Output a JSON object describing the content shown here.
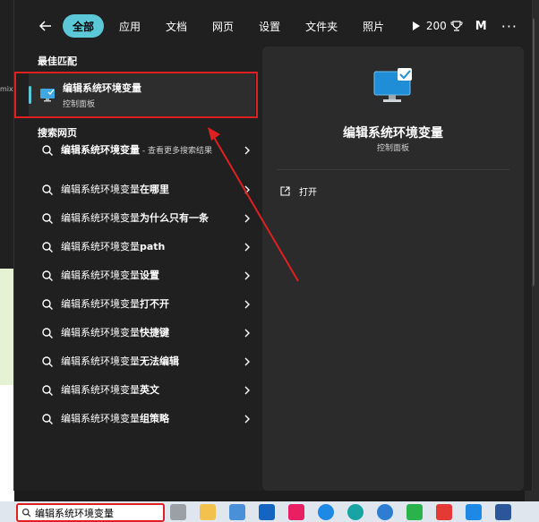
{
  "background": {
    "left_snippet": "mixe"
  },
  "topbar": {
    "filters": [
      {
        "label": "全部",
        "active": true
      },
      {
        "label": "应用",
        "active": false
      },
      {
        "label": "文档",
        "active": false
      },
      {
        "label": "网页",
        "active": false
      },
      {
        "label": "设置",
        "active": false
      },
      {
        "label": "文件夹",
        "active": false
      },
      {
        "label": "照片",
        "active": false
      }
    ],
    "points": "200",
    "avatar": "M",
    "more": "···"
  },
  "best_match": {
    "section_title": "最佳匹配",
    "name": "编辑系统环境变量",
    "subtitle": "控制面板"
  },
  "web_search": {
    "section_title": "搜索网页",
    "items": [
      {
        "base": "编辑系统环境变量",
        "bold": "",
        "suffix": " - 查看更多搜索结果"
      },
      {
        "base": "编辑系统环境变量",
        "bold": "在哪里",
        "suffix": ""
      },
      {
        "base": "编辑系统环境变量",
        "bold": "为什么只有一条",
        "suffix": ""
      },
      {
        "base": "编辑系统环境变量",
        "bold": "path",
        "suffix": ""
      },
      {
        "base": "编辑系统环境变量",
        "bold": "设置",
        "suffix": ""
      },
      {
        "base": "编辑系统环境变量",
        "bold": "打不开",
        "suffix": ""
      },
      {
        "base": "编辑系统环境变量",
        "bold": "快捷键",
        "suffix": ""
      },
      {
        "base": "编辑系统环境变量",
        "bold": "无法编辑",
        "suffix": ""
      },
      {
        "base": "编辑系统环境变量",
        "bold": "英文",
        "suffix": ""
      },
      {
        "base": "编辑系统环境变量",
        "bold": "组策略",
        "suffix": ""
      }
    ]
  },
  "detail": {
    "title": "编辑系统环境变量",
    "subtitle": "控制面板",
    "open_label": "打开"
  },
  "taskbar": {
    "search_value": "编辑系统环境变量",
    "apps": [
      "file-stack",
      "file-explorer",
      "store",
      "lens-l",
      "app-pink",
      "app-k",
      "edge",
      "edge-dev",
      "wechat",
      "wps",
      "vscode",
      "word"
    ]
  },
  "colors": {
    "accent": "#5cc7d6",
    "annotation": "#e02020"
  }
}
